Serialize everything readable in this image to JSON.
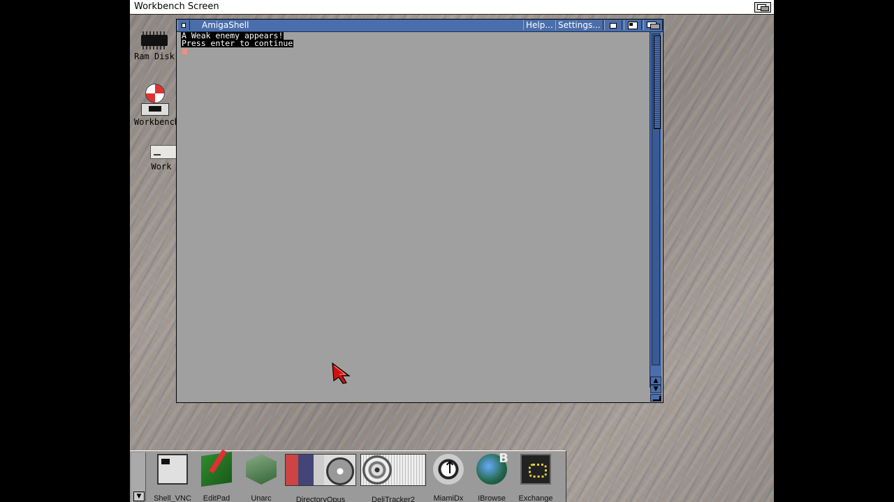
{
  "screen": {
    "title": "Workbench Screen"
  },
  "desktop_icons": [
    {
      "label": "Ram Disk"
    },
    {
      "label": "Workbench"
    },
    {
      "label": "Work"
    }
  ],
  "shell_window": {
    "title": "AmigaShell",
    "help_label": "Help...",
    "settings_label": "Settings...",
    "output_lines": [
      "A Weak enemy appears!",
      "Press enter to continue"
    ]
  },
  "dock": {
    "items": [
      {
        "label": "Shell_VNC",
        "icon": "shell-icon"
      },
      {
        "label": "EditPad",
        "icon": "editpad-icon"
      },
      {
        "label": "Unarc",
        "icon": "unarc-icon"
      },
      {
        "label": "DirectoryOpus",
        "icon": "directory-opus-icon"
      },
      {
        "label": "DeliTracker2",
        "icon": "delitracker-icon"
      },
      {
        "label": "MiamiDx",
        "icon": "miami-icon"
      },
      {
        "label": "IBrowse",
        "icon": "ibrowse-icon"
      },
      {
        "label": "Exchange",
        "icon": "exchange-icon"
      }
    ]
  },
  "colors": {
    "window_title_bar": "#4a6eab",
    "window_background": "#a0a0a0",
    "cursor": "#f09080",
    "pointer": "#d01010"
  }
}
